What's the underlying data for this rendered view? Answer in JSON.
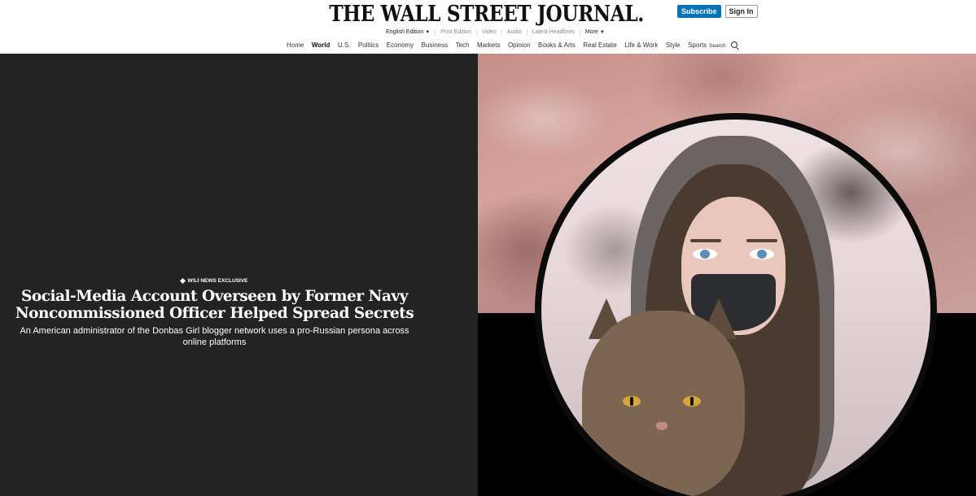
{
  "header": {
    "masthead": "THE WALL STREET JOURNAL.",
    "subscribe_label": "Subscribe",
    "signin_label": "Sign In",
    "subnav": {
      "edition": "English Edition",
      "print": "Print Edition",
      "video": "Video",
      "audio": "Audio",
      "latest": "Latest Headlines",
      "more": "More"
    },
    "nav": {
      "home": "Home",
      "world": "World",
      "us": "U.S.",
      "politics": "Politics",
      "economy": "Economy",
      "business": "Business",
      "tech": "Tech",
      "markets": "Markets",
      "opinion": "Opinion",
      "books_arts": "Books & Arts",
      "real_estate": "Real Estate",
      "life_work": "Life & Work",
      "style": "Style",
      "sports": "Sports"
    },
    "search_label": "Search"
  },
  "hero": {
    "kicker": "WSJ NEWS EXCLUSIVE",
    "headline_line1": "Social-Media Account Overseen by Former Navy",
    "headline_line2": "Noncommissioned Officer Helped Spread Secrets",
    "dek": "An American administrator of the Donbas Girl blogger network uses a pro-Russian persona across online platforms"
  },
  "colors": {
    "subscribe_bg": "#0274b6",
    "hero_left_bg": "#232323",
    "hero_right_bg": "#000000"
  }
}
